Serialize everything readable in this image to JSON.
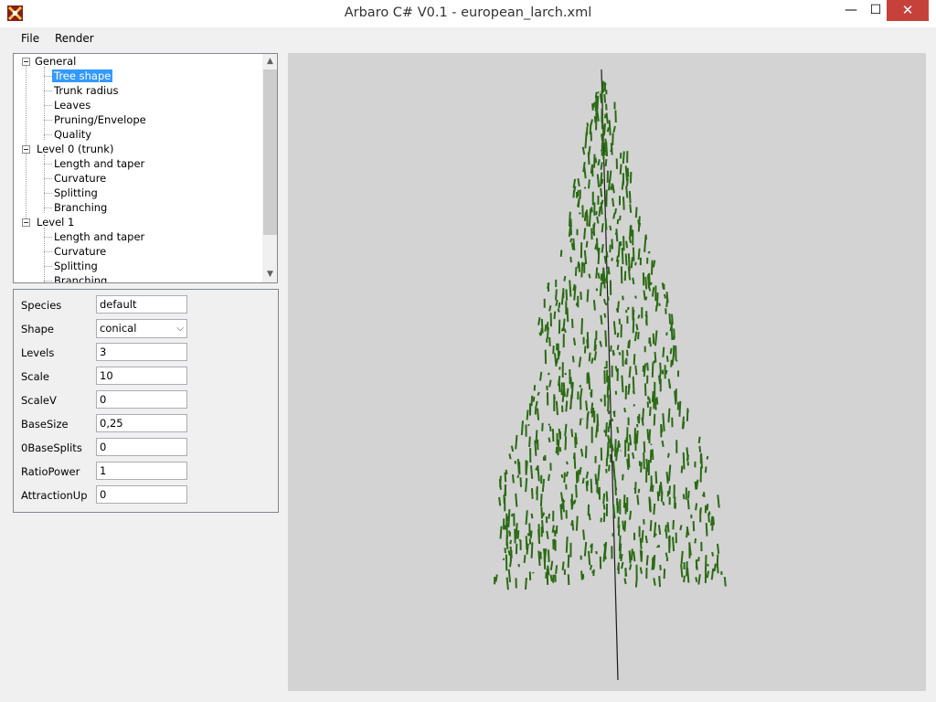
{
  "window": {
    "title": "Arbaro C# V0.1 - european_larch.xml",
    "minimize_glyph": "—",
    "maximize_glyph": "☐",
    "close_glyph": "✕"
  },
  "menu": {
    "file": "File",
    "render": "Render"
  },
  "tree": {
    "rows": [
      {
        "label": "General",
        "level": 0
      },
      {
        "label": "Tree shape",
        "level": 1,
        "selected": true
      },
      {
        "label": "Trunk radius",
        "level": 1
      },
      {
        "label": "Leaves",
        "level": 1
      },
      {
        "label": "Pruning/Envelope",
        "level": 1
      },
      {
        "label": "Quality",
        "level": 1
      },
      {
        "label": "Level 0 (trunk)",
        "level": 0
      },
      {
        "label": "Length and taper",
        "level": 1
      },
      {
        "label": "Curvature",
        "level": 1
      },
      {
        "label": "Splitting",
        "level": 1
      },
      {
        "label": "Branching",
        "level": 1
      },
      {
        "label": "Level 1",
        "level": 0
      },
      {
        "label": "Length and taper",
        "level": 1
      },
      {
        "label": "Curvature",
        "level": 1
      },
      {
        "label": "Splitting",
        "level": 1
      },
      {
        "label": "Branching",
        "level": 1
      }
    ]
  },
  "props": {
    "species": {
      "label": "Species",
      "value": "default"
    },
    "shape": {
      "label": "Shape",
      "value": "conical"
    },
    "levels": {
      "label": "Levels",
      "value": "3"
    },
    "scale": {
      "label": "Scale",
      "value": "10"
    },
    "scalev": {
      "label": "ScaleV",
      "value": "0"
    },
    "basesize": {
      "label": "BaseSize",
      "value": "0,25"
    },
    "basesplits": {
      "label": "0BaseSplits",
      "value": "0"
    },
    "ratiopower": {
      "label": "RatioPower",
      "value": "1"
    },
    "attractionup": {
      "label": "AttractionUp",
      "value": "0"
    }
  },
  "colors": {
    "selection": "#3399ff",
    "close": "#c7413b",
    "foliage": "#2a6a14",
    "render_bg": "#d3d3d3"
  },
  "icons": {
    "app": "arbaro-app-icon",
    "scroll_up": "chevron-up-icon",
    "scroll_down": "chevron-down-icon",
    "select": "chevron-down-icon"
  }
}
